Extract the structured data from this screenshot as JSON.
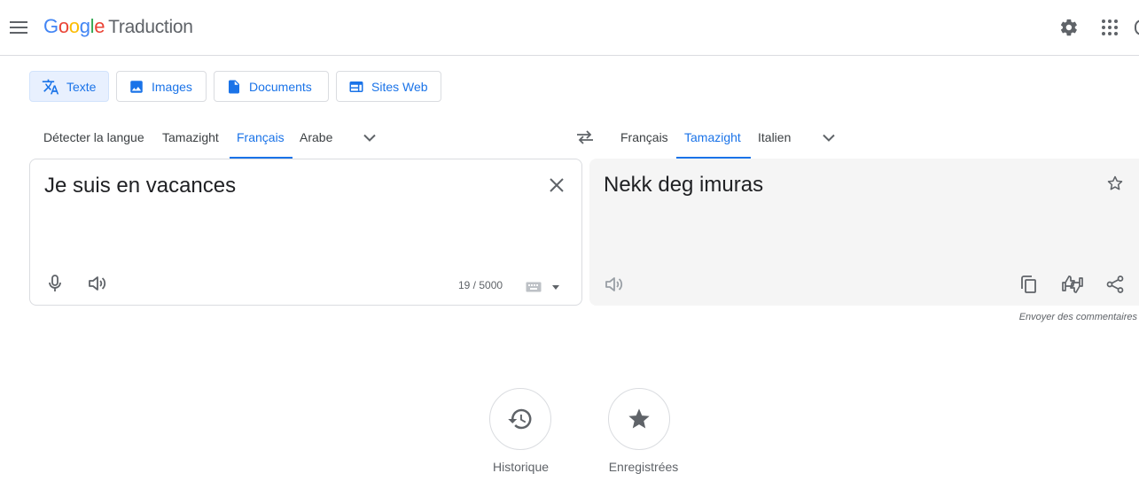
{
  "header": {
    "logo_letters": [
      "G",
      "o",
      "o",
      "g",
      "l",
      "e"
    ],
    "product": "Traduction"
  },
  "modes": [
    {
      "label": "Texte",
      "icon": "translate-icon",
      "active": true
    },
    {
      "label": "Images",
      "icon": "image-icon",
      "active": false
    },
    {
      "label": "Documents",
      "icon": "document-icon",
      "active": false
    },
    {
      "label": "Sites Web",
      "icon": "website-icon",
      "active": false
    }
  ],
  "source_langs": [
    "Détecter la langue",
    "Tamazight",
    "Français",
    "Arabe"
  ],
  "source_selected": "Français",
  "target_langs": [
    "Français",
    "Tamazight",
    "Italien"
  ],
  "target_selected": "Tamazight",
  "source": {
    "text": "Je suis en vacances",
    "counter": "19 / 5000"
  },
  "target": {
    "text": "Nekk deg imuras"
  },
  "feedback": "Envoyer des commentaires",
  "bottom": {
    "history": "Historique",
    "saved": "Enregistrées"
  },
  "colors": {
    "accent": "#1a73e8",
    "active_mode_bg": "#e8f0fe",
    "target_panel_bg": "#f5f5f5"
  }
}
